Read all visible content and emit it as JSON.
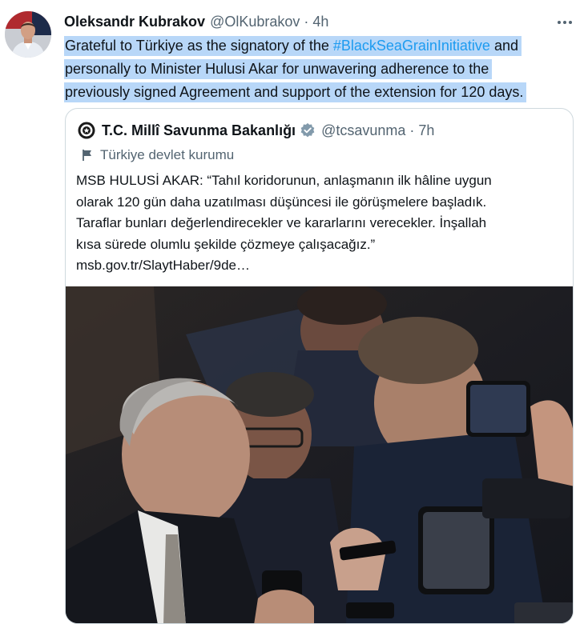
{
  "tweet": {
    "author_name": "Oleksandr Kubrakov",
    "author_handle": "@OlKubrakov",
    "separator": "·",
    "timestamp": "4h",
    "text_lines": [
      {
        "before": "Grateful to Türkiye as the signatory of the ",
        "hashtag": "#BlackSeaGrainInitiative",
        "after": " and"
      },
      {
        "before": "personally to Minister Hulusi Akar for unwavering adherence to the"
      },
      {
        "before": "previously signed Agreement and support of the extension for 120 days."
      }
    ]
  },
  "quoted_tweet": {
    "author_name": "T.C. Millî Savunma Bakanlığı",
    "author_handle": "@tcsavunma",
    "separator": "·",
    "timestamp": "7h",
    "affiliation_label": "Türkiye devlet kurumu",
    "text_lines": [
      "MSB HULUSİ AKAR: “Tahıl koridorunun, anlaşmanın ilk hâline uygun",
      "olarak 120 gün daha uzatılması düşüncesi ile görüşmelere başladık.",
      "Taraflar bunları değerlendirecekler ve kararlarını verecekler. İnşallah",
      "kısa sürede olumlu şekilde çözmeye çalışacağız.”"
    ],
    "link_text": "msb.gov.tr/SlaytHaber/9de…"
  },
  "icons": {
    "more": "more-horizontal-icon",
    "verified": "verified-badge-icon",
    "affiliation": "flag-icon",
    "logo": "ministry-seal-icon"
  },
  "colors": {
    "accent": "#1d9bf0",
    "selection_highlight": "#b8d7f8",
    "secondary_text": "#536471",
    "verified_badge": "#829aab",
    "border": "#cfd9de"
  }
}
